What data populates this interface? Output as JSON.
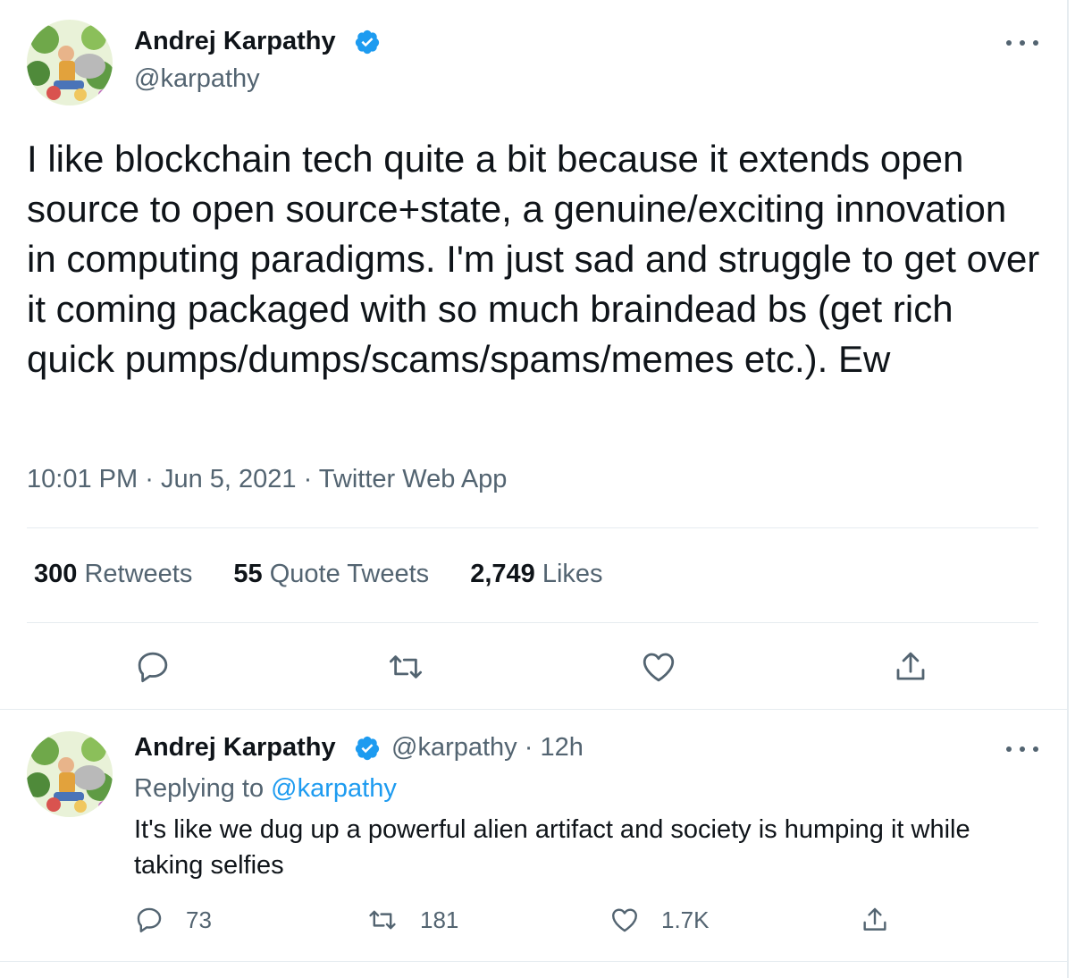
{
  "tweet": {
    "author_name": "Andrej Karpathy",
    "author_handle": "@karpathy",
    "text": "I like blockchain tech quite a bit because it extends open source to open source+state, a genuine/exciting innovation in computing paradigms. I'm just sad and struggle to get over it coming packaged with so much braindead bs (get rich quick pumps/dumps/scams/spams/memes etc.). Ew",
    "time": "10:01 PM",
    "date": "Jun 5, 2021",
    "source": "Twitter Web App",
    "separator": "·",
    "stats": [
      {
        "count": "300",
        "label": "Retweets"
      },
      {
        "count": "55",
        "label": "Quote Tweets"
      },
      {
        "count": "2,749",
        "label": "Likes"
      }
    ],
    "actions": [
      "reply-icon",
      "retweet-icon",
      "like-icon",
      "share-icon"
    ]
  },
  "reply": {
    "author_name": "Andrej Karpathy",
    "author_handle": "@karpathy",
    "time_ago": "12h",
    "replying_to_label": "Replying to",
    "replying_to_handle": "@karpathy",
    "text": "It's like we dug up a powerful alien artifact and society is humping it while taking selfies",
    "reply_count": "73",
    "retweet_count": "181",
    "like_count": "1.7K"
  },
  "colors": {
    "text": "#0f1419",
    "secondary": "#536471",
    "accent": "#1d9bf0",
    "divider": "#e6ecf0"
  }
}
